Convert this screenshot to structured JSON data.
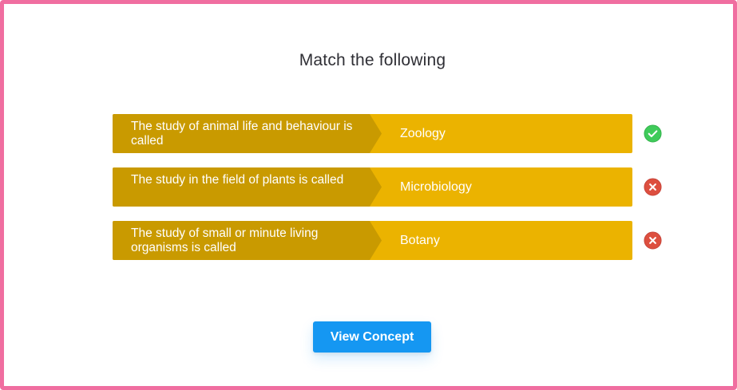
{
  "header": {
    "title": "Match the following"
  },
  "rows": [
    {
      "question": "The study of animal life and behaviour is called",
      "answer": "Zoology",
      "status": "correct",
      "status_icon": "check-icon"
    },
    {
      "question": "The study in the field of plants is called",
      "answer": "Microbiology",
      "status": "incorrect",
      "status_icon": "close-icon"
    },
    {
      "question": "The study of small or minute living organisms is called",
      "answer": "Botany",
      "status": "incorrect",
      "status_icon": "close-icon"
    }
  ],
  "actions": {
    "view_concept_label": "View Concept"
  },
  "colors": {
    "border": "#f06ea0",
    "row_answer_bg": "#ebb300",
    "row_question_bg": "#c99a00",
    "correct": "#3fcb5a",
    "incorrect": "#dd4f3f",
    "button": "#1597f2"
  }
}
